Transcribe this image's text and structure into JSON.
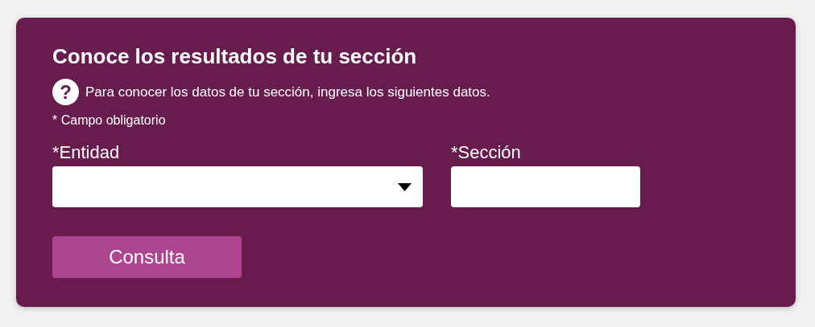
{
  "card": {
    "title": "Conoce los resultados de tu sección",
    "help_icon": "?",
    "instructions": "Para conocer los datos de tu sección, ingresa los siguientes datos.",
    "required_note": "* Campo obligatorio",
    "fields": [
      {
        "kind": "select",
        "label": "*Entidad"
      },
      {
        "kind": "text",
        "label": "*Sección"
      }
    ],
    "button": "Consulta"
  }
}
